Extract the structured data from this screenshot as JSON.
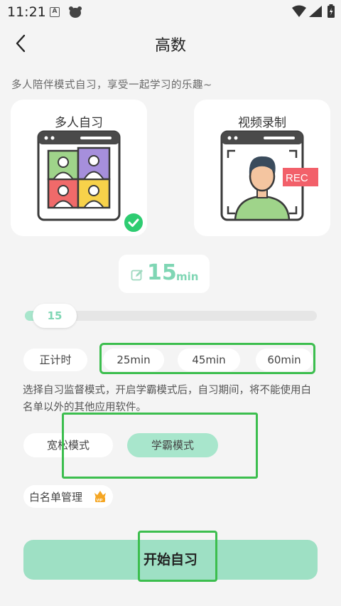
{
  "status_bar": {
    "time": "11:21",
    "notification_letter": "A",
    "icons": [
      "a-notification-icon",
      "bear-app-icon",
      "wifi-icon",
      "signal-icon",
      "battery-icon"
    ]
  },
  "header": {
    "title": "高数",
    "back_icon": "chevron-left-icon"
  },
  "subtitle": "多人陪伴模式自习，享受一起学习的乐趣~",
  "modes": [
    {
      "label": "多人自习",
      "selected": true
    },
    {
      "label": "视频录制",
      "selected": false,
      "rec_text": "REC"
    }
  ],
  "duration": {
    "value": "15",
    "unit": "min"
  },
  "slider": {
    "value_label": "15",
    "fill_fraction": 0.05
  },
  "timer_options": {
    "count_up": "正计时",
    "presets": [
      "25min",
      "45min",
      "60min"
    ]
  },
  "description": "选择自习监督模式，开启学霸模式后，自习期间，将不能使用白名单以外的其他应用软件。",
  "supervision_modes": {
    "relaxed": "宽松模式",
    "strict": "学霸模式",
    "selected": "strict"
  },
  "whitelist": {
    "label": "白名单管理",
    "badge": "VIP"
  },
  "start_button": "开始自习",
  "colors": {
    "accent": "#7fd6b4",
    "accent_light": "#a8e6cc",
    "annotation": "#3cbe4e",
    "check": "#2ecc71"
  }
}
